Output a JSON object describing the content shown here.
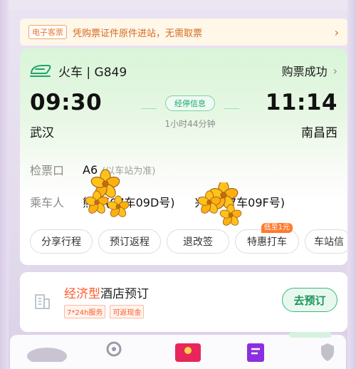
{
  "banner": {
    "tag": "电子客票",
    "text": "凭购票证件原件进站，无需取票",
    "chevron": "›"
  },
  "ticket": {
    "train_type": "火车",
    "train_no": "G849",
    "train_label": "火车 | G849",
    "status": "购票成功",
    "status_chevron": "›",
    "departure_time": "09:30",
    "arrival_time": "11:14",
    "departure_station": "武汉",
    "arrival_station": "南昌西",
    "stops_label": "经停信息",
    "duration": "1小时44分钟",
    "gate_label": "检票口",
    "gate_value": "A6",
    "gate_note": "(以车站为准)",
    "passenger_label": "乘车人",
    "passenger_1": "颖(07车09D号)",
    "passenger_1_prefix": "熊",
    "passenger_2": "通(07车09F号)",
    "passenger_2_prefix": "兴"
  },
  "actions": [
    {
      "label": "分享行程"
    },
    {
      "label": "预订返程"
    },
    {
      "label": "退改签"
    },
    {
      "label": "特惠打车",
      "badge": "低至1元"
    },
    {
      "label": "车站信"
    }
  ],
  "hotel": {
    "title_em": "经济型",
    "title_rest": "酒店预订",
    "tags": [
      "7*24h服务",
      "可返现金"
    ],
    "button": "去预订"
  },
  "colors": {
    "accent_green": "#19a96c",
    "orange": "#e8782e",
    "hotel_red": "#ff5a2a"
  },
  "icons": {
    "train": "train-icon",
    "hotel": "hotel-building-icon",
    "chevron": "chevron-right-icon",
    "sticker": "flower-sticker"
  }
}
